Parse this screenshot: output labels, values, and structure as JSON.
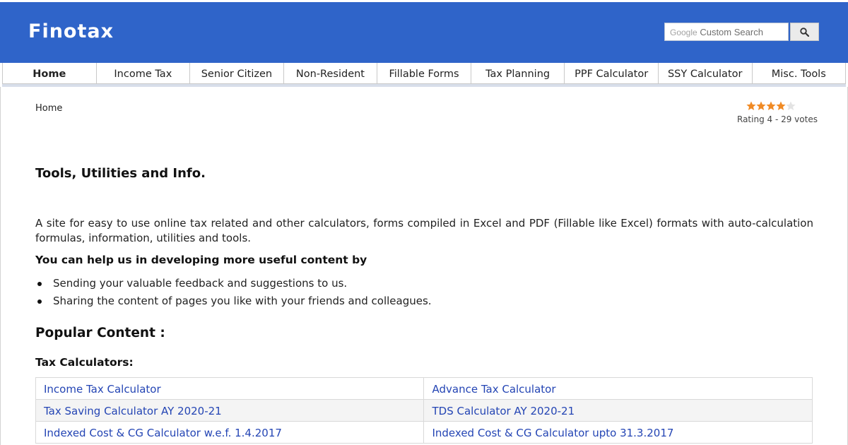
{
  "header": {
    "logo": "Finotax",
    "search": {
      "brand": "Google",
      "placeholder": "Custom Search"
    }
  },
  "nav": {
    "items": [
      {
        "label": "Home",
        "active": true
      },
      {
        "label": "Income Tax"
      },
      {
        "label": "Senior Citizen"
      },
      {
        "label": "Non-Resident"
      },
      {
        "label": "Fillable Forms"
      },
      {
        "label": "Tax Planning"
      },
      {
        "label": "PPF Calculator"
      },
      {
        "label": "SSY Calculator"
      },
      {
        "label": "Misc. Tools"
      }
    ]
  },
  "breadcrumb": "Home",
  "rating": {
    "stars_filled": 4,
    "stars_total": 5,
    "text": "Rating 4 - 29 votes",
    "star_color": "#f08a24"
  },
  "main": {
    "heading": "Tools, Utilities and Info.",
    "intro": "A site for easy to use online tax related and other calculators, forms compiled in Excel and PDF (Fillable like Excel) formats with auto-calculation formulas, information, utilities and tools.",
    "help_heading": "You can help us in developing more useful content by",
    "bullets": [
      "Sending your valuable feedback and suggestions to us.",
      "Sharing the content of pages you like with your friends and colleagues."
    ],
    "popular_heading": "Popular Content :",
    "tax_calc_heading": "Tax Calculators:",
    "tax_calc_links": [
      [
        "Income Tax Calculator",
        "Advance Tax Calculator"
      ],
      [
        "Tax Saving Calculator AY 2020-21",
        "TDS Calculator AY 2020-21"
      ],
      [
        "Indexed Cost & CG Calculator w.e.f. 1.4.2017",
        "Indexed Cost & CG Calculator upto 31.3.2017"
      ]
    ]
  },
  "colors": {
    "header_bg": "#2f64c9",
    "link": "#2445b4"
  }
}
